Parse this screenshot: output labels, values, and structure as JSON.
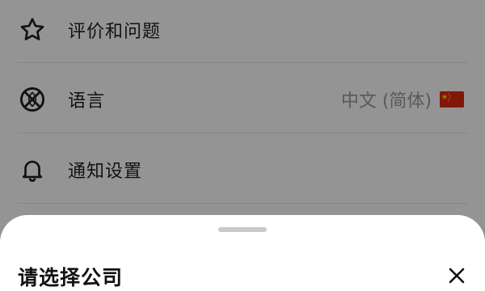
{
  "settings": {
    "items": [
      {
        "label": "评价和问题",
        "icon": "star-icon"
      },
      {
        "label": "语言",
        "icon": "language-icon",
        "value": "中文 (简体)",
        "flag": "china-flag-icon"
      },
      {
        "label": "通知设置",
        "icon": "bell-icon"
      }
    ]
  },
  "sheet": {
    "title": "请选择公司",
    "close_icon": "close-icon"
  },
  "colors": {
    "overlay": "rgba(0,0,0,0.42)",
    "flag_red": "#de2910",
    "flag_yellow": "#ffde00"
  }
}
